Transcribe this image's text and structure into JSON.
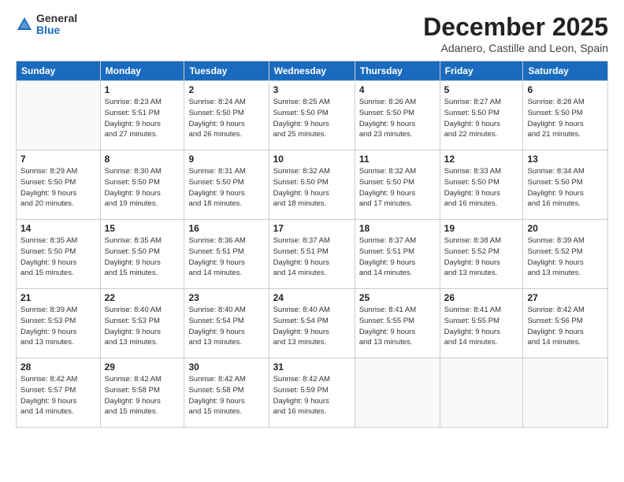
{
  "logo": {
    "general": "General",
    "blue": "Blue"
  },
  "title": "December 2025",
  "location": "Adanero, Castille and Leon, Spain",
  "days_header": [
    "Sunday",
    "Monday",
    "Tuesday",
    "Wednesday",
    "Thursday",
    "Friday",
    "Saturday"
  ],
  "weeks": [
    [
      {
        "num": "",
        "info": ""
      },
      {
        "num": "1",
        "info": "Sunrise: 8:23 AM\nSunset: 5:51 PM\nDaylight: 9 hours\nand 27 minutes."
      },
      {
        "num": "2",
        "info": "Sunrise: 8:24 AM\nSunset: 5:50 PM\nDaylight: 9 hours\nand 26 minutes."
      },
      {
        "num": "3",
        "info": "Sunrise: 8:25 AM\nSunset: 5:50 PM\nDaylight: 9 hours\nand 25 minutes."
      },
      {
        "num": "4",
        "info": "Sunrise: 8:26 AM\nSunset: 5:50 PM\nDaylight: 9 hours\nand 23 minutes."
      },
      {
        "num": "5",
        "info": "Sunrise: 8:27 AM\nSunset: 5:50 PM\nDaylight: 9 hours\nand 22 minutes."
      },
      {
        "num": "6",
        "info": "Sunrise: 8:28 AM\nSunset: 5:50 PM\nDaylight: 9 hours\nand 21 minutes."
      }
    ],
    [
      {
        "num": "7",
        "info": "Sunrise: 8:29 AM\nSunset: 5:50 PM\nDaylight: 9 hours\nand 20 minutes."
      },
      {
        "num": "8",
        "info": "Sunrise: 8:30 AM\nSunset: 5:50 PM\nDaylight: 9 hours\nand 19 minutes."
      },
      {
        "num": "9",
        "info": "Sunrise: 8:31 AM\nSunset: 5:50 PM\nDaylight: 9 hours\nand 18 minutes."
      },
      {
        "num": "10",
        "info": "Sunrise: 8:32 AM\nSunset: 5:50 PM\nDaylight: 9 hours\nand 18 minutes."
      },
      {
        "num": "11",
        "info": "Sunrise: 8:32 AM\nSunset: 5:50 PM\nDaylight: 9 hours\nand 17 minutes."
      },
      {
        "num": "12",
        "info": "Sunrise: 8:33 AM\nSunset: 5:50 PM\nDaylight: 9 hours\nand 16 minutes."
      },
      {
        "num": "13",
        "info": "Sunrise: 8:34 AM\nSunset: 5:50 PM\nDaylight: 9 hours\nand 16 minutes."
      }
    ],
    [
      {
        "num": "14",
        "info": "Sunrise: 8:35 AM\nSunset: 5:50 PM\nDaylight: 9 hours\nand 15 minutes."
      },
      {
        "num": "15",
        "info": "Sunrise: 8:35 AM\nSunset: 5:50 PM\nDaylight: 9 hours\nand 15 minutes."
      },
      {
        "num": "16",
        "info": "Sunrise: 8:36 AM\nSunset: 5:51 PM\nDaylight: 9 hours\nand 14 minutes."
      },
      {
        "num": "17",
        "info": "Sunrise: 8:37 AM\nSunset: 5:51 PM\nDaylight: 9 hours\nand 14 minutes."
      },
      {
        "num": "18",
        "info": "Sunrise: 8:37 AM\nSunset: 5:51 PM\nDaylight: 9 hours\nand 14 minutes."
      },
      {
        "num": "19",
        "info": "Sunrise: 8:38 AM\nSunset: 5:52 PM\nDaylight: 9 hours\nand 13 minutes."
      },
      {
        "num": "20",
        "info": "Sunrise: 8:39 AM\nSunset: 5:52 PM\nDaylight: 9 hours\nand 13 minutes."
      }
    ],
    [
      {
        "num": "21",
        "info": "Sunrise: 8:39 AM\nSunset: 5:53 PM\nDaylight: 9 hours\nand 13 minutes."
      },
      {
        "num": "22",
        "info": "Sunrise: 8:40 AM\nSunset: 5:53 PM\nDaylight: 9 hours\nand 13 minutes."
      },
      {
        "num": "23",
        "info": "Sunrise: 8:40 AM\nSunset: 5:54 PM\nDaylight: 9 hours\nand 13 minutes."
      },
      {
        "num": "24",
        "info": "Sunrise: 8:40 AM\nSunset: 5:54 PM\nDaylight: 9 hours\nand 13 minutes."
      },
      {
        "num": "25",
        "info": "Sunrise: 8:41 AM\nSunset: 5:55 PM\nDaylight: 9 hours\nand 13 minutes."
      },
      {
        "num": "26",
        "info": "Sunrise: 8:41 AM\nSunset: 5:55 PM\nDaylight: 9 hours\nand 14 minutes."
      },
      {
        "num": "27",
        "info": "Sunrise: 8:42 AM\nSunset: 5:56 PM\nDaylight: 9 hours\nand 14 minutes."
      }
    ],
    [
      {
        "num": "28",
        "info": "Sunrise: 8:42 AM\nSunset: 5:57 PM\nDaylight: 9 hours\nand 14 minutes."
      },
      {
        "num": "29",
        "info": "Sunrise: 8:42 AM\nSunset: 5:58 PM\nDaylight: 9 hours\nand 15 minutes."
      },
      {
        "num": "30",
        "info": "Sunrise: 8:42 AM\nSunset: 5:58 PM\nDaylight: 9 hours\nand 15 minutes."
      },
      {
        "num": "31",
        "info": "Sunrise: 8:42 AM\nSunset: 5:59 PM\nDaylight: 9 hours\nand 16 minutes."
      },
      {
        "num": "",
        "info": ""
      },
      {
        "num": "",
        "info": ""
      },
      {
        "num": "",
        "info": ""
      }
    ]
  ]
}
